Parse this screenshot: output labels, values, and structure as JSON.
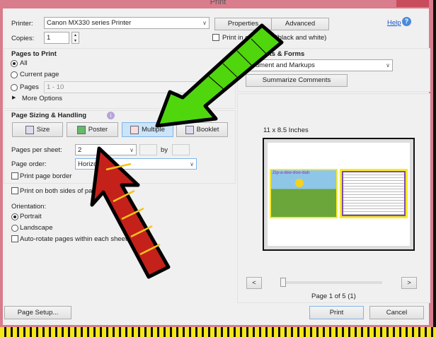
{
  "window": {
    "title": "Print"
  },
  "printer": {
    "label": "Printer:",
    "value": "Canon MX330 series Printer",
    "properties": "Properties",
    "advanced": "Advanced",
    "help": "Help"
  },
  "copies": {
    "label": "Copies:",
    "value": "1",
    "grayscale": "Print in grayscale (black and white)"
  },
  "pages_to_print": {
    "title": "Pages to Print",
    "all": "All",
    "current": "Current page",
    "pages": "Pages",
    "pages_range": "1 - 10",
    "more": "More Options"
  },
  "comments": {
    "title": "Comments & Forms",
    "value": "Document and Markups",
    "summarize": "Summarize Comments"
  },
  "sizing": {
    "title": "Page Sizing & Handling",
    "buttons": [
      "Size",
      "Poster",
      "Multiple",
      "Booklet"
    ],
    "selected": "Multiple",
    "pps_label": "Pages per sheet:",
    "pps_value": "2",
    "by": "by",
    "order_label": "Page order:",
    "order_value": "Horizontal",
    "border": "Print page border"
  },
  "both_sides": "Print on both sides of paper",
  "orientation": {
    "title": "Orientation:",
    "portrait": "Portrait",
    "landscape": "Landscape",
    "autorotate": "Auto-rotate pages within each sheet"
  },
  "preview": {
    "size": "11 x 8.5 Inches",
    "page_info": "Page 1 of 5 (1)",
    "prev": "<",
    "next": ">",
    "slider_fraction": 0,
    "thumb_title": "Zip-a-dee-doo-dah"
  },
  "footer": {
    "setup": "Page Setup...",
    "print": "Print",
    "cancel": "Cancel"
  },
  "colors": {
    "arrow_green": "#4fd60d",
    "arrow_red": "#c4211a",
    "selected_button": "#cce4f7"
  }
}
